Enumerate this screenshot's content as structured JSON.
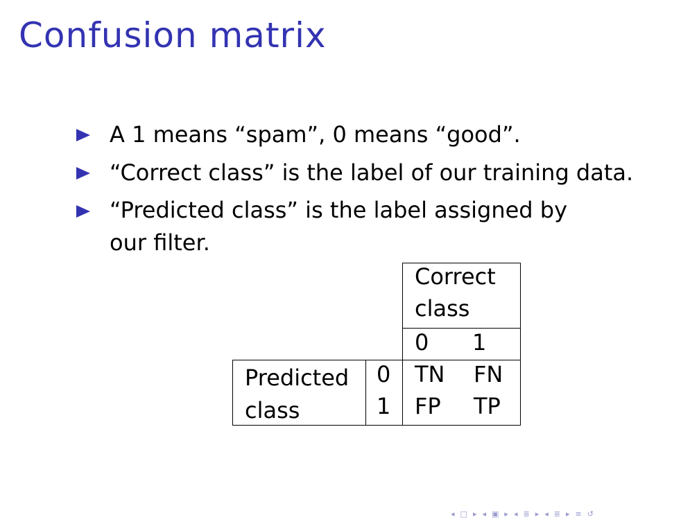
{
  "slide": {
    "title": "Confusion matrix",
    "bullets": [
      "A 1 means “spam”, 0 means “good”.",
      "“Correct class” is the label of our training data.",
      "“Predicted class” is the label assigned by our filter."
    ]
  },
  "matrix": {
    "correct_header_line1": "Correct",
    "correct_header_line2": "class",
    "col_labels": [
      "0",
      "1"
    ],
    "predicted_label_line1": "Predicted",
    "predicted_label_line2": "class",
    "row_labels": [
      "0",
      "1"
    ],
    "cells": [
      [
        "TN",
        "FN"
      ],
      [
        "FP",
        "TP"
      ]
    ]
  },
  "nav": {
    "icons": [
      "nav-left-icon",
      "frame-icon",
      "nav-right-icon",
      "nav-left-icon",
      "subsection-icon",
      "nav-right-icon",
      "nav-left-icon",
      "section-icon",
      "nav-right-icon",
      "nav-left-icon",
      "slide-icon",
      "nav-right-icon",
      "align-icon",
      "search-icon"
    ],
    "accent": "#3333b2"
  }
}
